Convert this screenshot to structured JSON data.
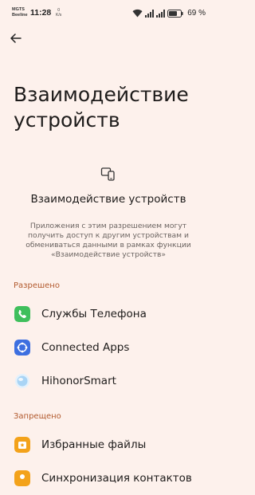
{
  "status_bar": {
    "carrier_1": "MGTS",
    "carrier_2": "Beeline",
    "time": "11:28",
    "net_speed_value": "0",
    "net_speed_unit": "K/s",
    "battery_percent": "69 %",
    "icons": [
      "wifi-icon",
      "signal-icon",
      "signal-icon",
      "battery-icon"
    ]
  },
  "header": {
    "back_icon": "arrow-left-icon",
    "title": "Взаимодействие устройств"
  },
  "hero": {
    "icon": "devices-icon",
    "heading": "Взаимодействие устройств",
    "description": "Приложения с этим разрешением могут получить доступ к другим устройствам и обмениваться данными в рамках функции «Взаимодействие устройств»"
  },
  "allowed": {
    "label": "Разрешено",
    "items": [
      {
        "label": "Службы Телефона",
        "icon": "phone-icon",
        "color": "#3fbf5c"
      },
      {
        "label": "Connected Apps",
        "icon": "connected-apps-icon",
        "color": "#3d6fe0"
      },
      {
        "label": "HihonorSmart",
        "icon": "hihonor-smart-icon",
        "color": "#a9d4f5"
      }
    ]
  },
  "denied": {
    "label": "Запрещено",
    "items": [
      {
        "label": "Избранные файлы",
        "icon": "favorite-files-icon",
        "color": "#f3a21a"
      },
      {
        "label": "Синхронизация контактов",
        "icon": "contacts-sync-icon",
        "color": "#f3a21a"
      }
    ]
  },
  "colors": {
    "background": "#fdf1ec",
    "accent": "#b25a2e"
  }
}
